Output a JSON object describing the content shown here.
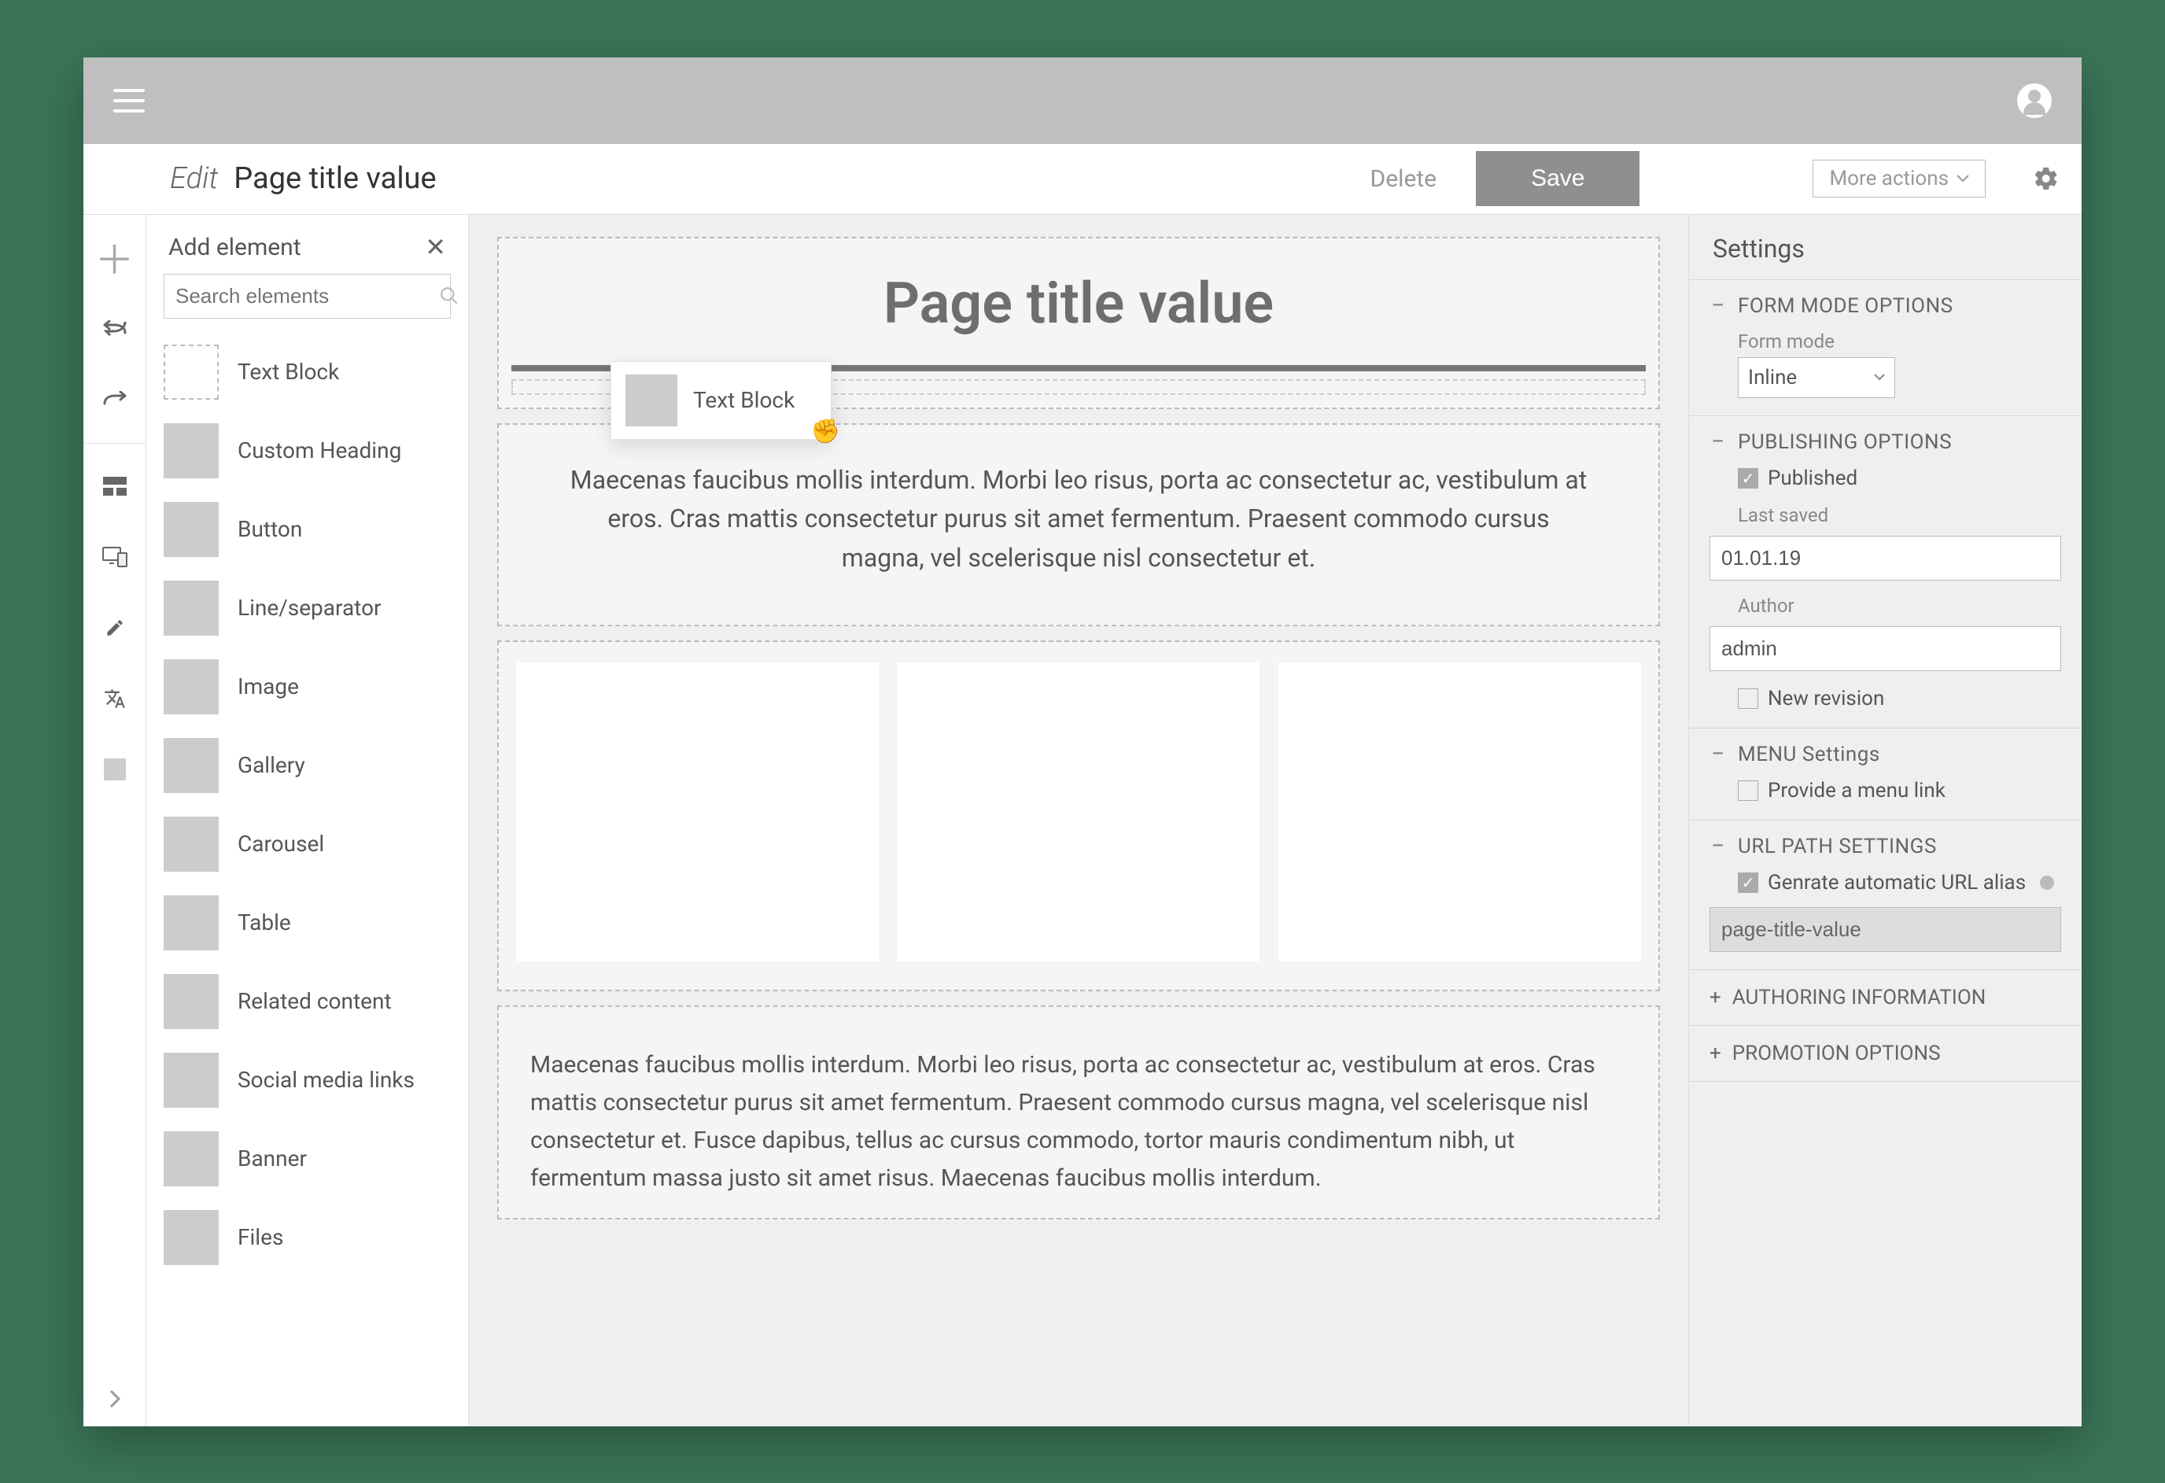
{
  "titlebar": {
    "edit_label": "Edit",
    "page_title": "Page title value",
    "delete": "Delete",
    "save": "Save",
    "more_actions": "More actions"
  },
  "add_panel": {
    "title": "Add element",
    "search_placeholder": "Search elements",
    "items": [
      "Text Block",
      "Custom Heading",
      "Button",
      "Line/separator",
      "Image",
      "Gallery",
      "Carousel",
      "Table",
      "Related content",
      "Social media links",
      "Banner",
      "Files"
    ]
  },
  "drag_ghost": {
    "label": "Text Block"
  },
  "canvas": {
    "title": "Page title value",
    "para1": "Maecenas faucibus mollis interdum. Morbi leo risus, porta ac consectetur ac, vestibulum at eros. Cras mattis consectetur purus sit amet fermentum. Praesent commodo cursus magna, vel scelerisque nisl consectetur et.",
    "para2": "Maecenas faucibus mollis interdum. Morbi leo risus, porta ac consectetur ac, vestibulum at eros. Cras mattis consectetur purus sit amet fermentum. Praesent commodo cursus magna, vel scelerisque nisl consectetur et. Fusce dapibus, tellus ac cursus commodo, tortor mauris condimentum nibh, ut fermentum massa justo sit amet risus. Maecenas faucibus mollis interdum."
  },
  "settings": {
    "title": "Settings",
    "form_mode": {
      "heading": "FORM MODE OPTIONS",
      "label": "Form mode",
      "value": "Inline"
    },
    "publishing": {
      "heading": "PUBLISHING OPTIONS",
      "published_label": "Published",
      "last_saved_label": "Last saved",
      "last_saved_value": "01.01.19",
      "author_label": "Author",
      "author_value": "admin",
      "new_revision_label": "New revision"
    },
    "menu": {
      "heading": "MENU Settings",
      "provide_link_label": "Provide a menu link"
    },
    "url": {
      "heading": "URL PATH SETTINGS",
      "auto_label": "Genrate automatic URL alias",
      "alias_value": "page-title-value"
    },
    "authoring": {
      "heading": "AUTHORING INFORMATION"
    },
    "promotion": {
      "heading": "PROMOTION OPTIONS"
    }
  }
}
